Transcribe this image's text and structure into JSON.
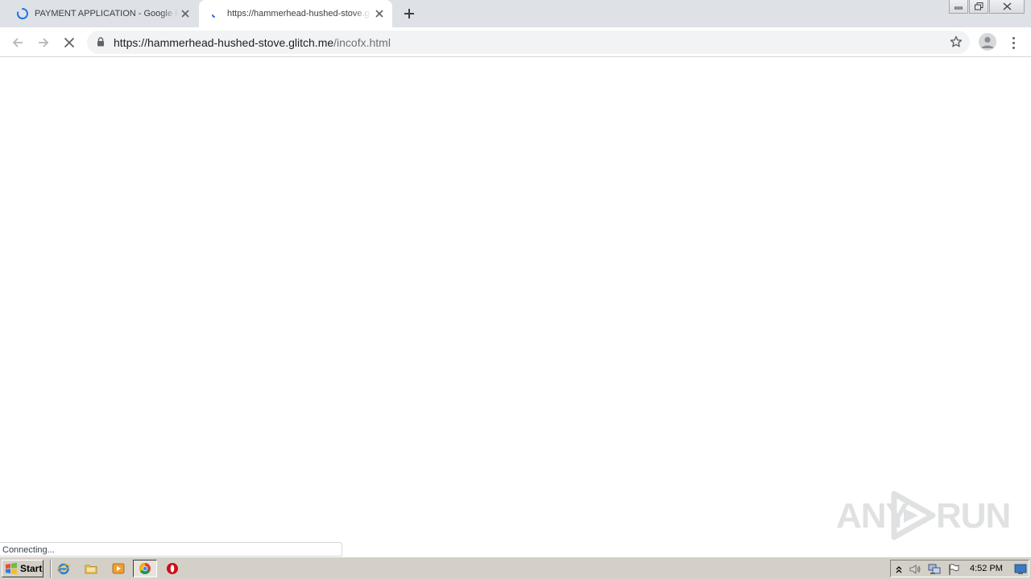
{
  "browser": {
    "tabs": [
      {
        "title": "PAYMENT APPLICATION - Google Preview",
        "loading": true,
        "active": false
      },
      {
        "title": "https://hammerhead-hushed-stove.glitch.me/incofx.html",
        "loading": true,
        "active": true
      }
    ],
    "address_bar": {
      "host": "https://hammerhead-hushed-stove.glitch.me",
      "path": "/incofx.html",
      "secure": true
    },
    "status_text": "Connecting..."
  },
  "watermark": {
    "left": "ANY",
    "right": "RUN"
  },
  "taskbar": {
    "start_label": "Start",
    "clock": "4:52 PM"
  },
  "colors": {
    "tabstrip": "#dee1e6",
    "omnibox": "#f1f3f4",
    "spinner": "#1a73e8",
    "taskbar": "#d4d0c8"
  }
}
